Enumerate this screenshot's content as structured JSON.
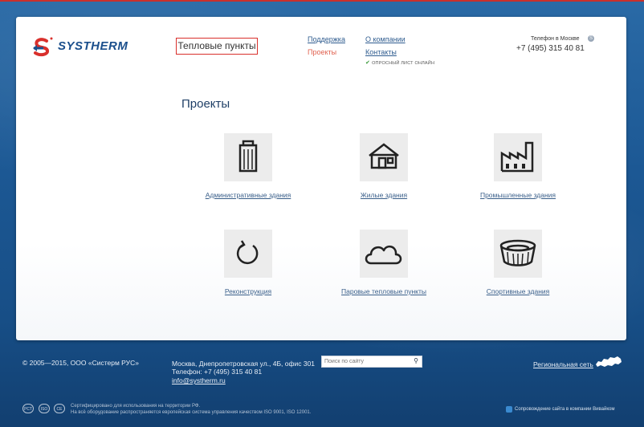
{
  "header": {
    "logo_text": "SYSTHERM",
    "main_nav": "Тепловые пункты",
    "nav_support": "Поддержка",
    "nav_projects": "Проекты",
    "nav_about": "О компании",
    "nav_contacts": "Контакты",
    "survey": "ОПРОСНЫЙ ЛИСТ ОНЛАЙН",
    "phone_label": "Телефон в Москве",
    "phone_number": "+7 (495) 315 40 81"
  },
  "main": {
    "title": "Проекты",
    "tiles": [
      {
        "label": "Административные здания",
        "icon": "office-building-icon"
      },
      {
        "label": "Жилые здания",
        "icon": "house-icon"
      },
      {
        "label": "Промышленные здания",
        "icon": "factory-icon"
      },
      {
        "label": "Реконструкция",
        "icon": "refresh-icon"
      },
      {
        "label": "Паровые тепловые пункты",
        "icon": "cloud-icon"
      },
      {
        "label": "Спортивные здания",
        "icon": "stadium-icon"
      }
    ]
  },
  "footer": {
    "copyright": "© 2005—2015, ООО «Систерм РУС»",
    "address": "Москва, Днепропетровская ул., 4Б, офис 301",
    "phone": "Телефон: +7 (495) 315 40 81",
    "email": "info@systherm.ru",
    "search_placeholder": "Поиск по сайту",
    "regional": "Региональная сеть",
    "cert_line1": "Сертифицировано для использования на территории РФ.",
    "cert_line2": "На всё оборудование распространяется европейская система управления качеством ISO 9001, ISO 12001.",
    "support": "Сопровождение сайта в компании Вивайком",
    "cert_icons": [
      "РСТ",
      "ISO",
      "CE"
    ]
  },
  "colors": {
    "brand": "#1b4f8c",
    "accent": "#d9302c",
    "link": "#3a5f8a"
  }
}
